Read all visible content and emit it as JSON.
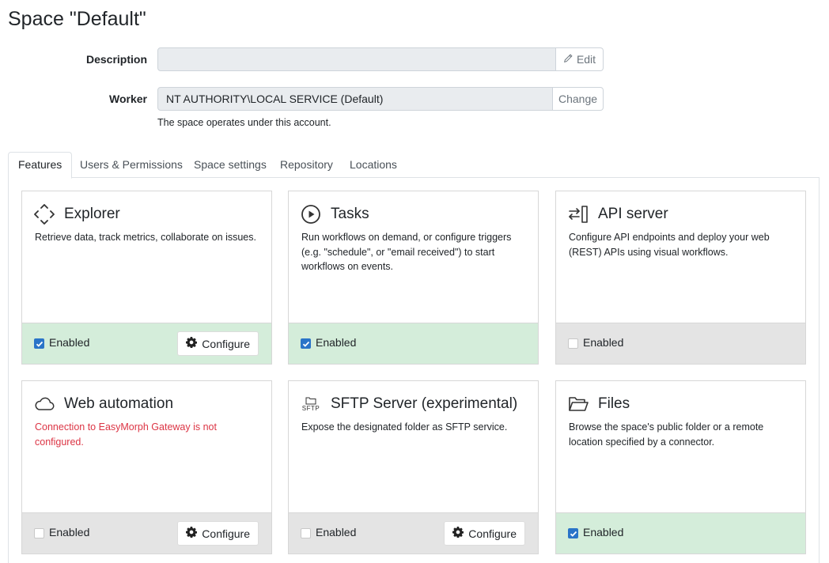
{
  "page": {
    "title": "Space \"Default\""
  },
  "description": {
    "label": "Description",
    "value": "",
    "edit_label": "Edit"
  },
  "worker": {
    "label": "Worker",
    "value": "NT AUTHORITY\\LOCAL SERVICE (Default)",
    "change_label": "Change",
    "help": "The space operates under this account."
  },
  "tabs": [
    "Features",
    "Users & Permissions",
    "Space settings",
    "Repository",
    "Locations"
  ],
  "active_tab": "Features",
  "colors": {
    "enabled_bg": "#d4edda",
    "disabled_bg": "#e4e4e4",
    "error": "#dc3545",
    "checkbox": "#2a74c8"
  },
  "features": [
    {
      "title": "Explorer",
      "icon": "move-arrows-icon",
      "desc": "Retrieve data, track metrics, collaborate on issues.",
      "enabled": true,
      "enabled_label": "Enabled",
      "configure_label": "Configure"
    },
    {
      "title": "Tasks",
      "icon": "play-circle-icon",
      "desc": "Run workflows on demand, or configure triggers (e.g. \"schedule\", or \"email received\") to start workflows on events.",
      "enabled": true,
      "enabled_label": "Enabled"
    },
    {
      "title": "API server",
      "icon": "api-exchange-icon",
      "desc": "Configure API endpoints and deploy your web (REST) APIs using visual workflows.",
      "enabled": false,
      "enabled_label": "Enabled"
    },
    {
      "title": "Web automation",
      "icon": "cloud-icon",
      "desc": "Connection to EasyMorph Gateway is not configured.",
      "desc_error": true,
      "enabled": false,
      "enabled_label": "Enabled",
      "configure_label": "Configure"
    },
    {
      "title": "SFTP Server (experimental)",
      "icon": "sftp-folder-icon",
      "icon_caption": "SFTP",
      "desc": "Expose the designated folder as SFTP service.",
      "enabled": false,
      "enabled_label": "Enabled",
      "configure_label": "Configure"
    },
    {
      "title": "Files",
      "icon": "open-folder-icon",
      "desc": "Browse the space's public folder or a remote location specified by a connector.",
      "enabled": true,
      "enabled_label": "Enabled"
    }
  ]
}
